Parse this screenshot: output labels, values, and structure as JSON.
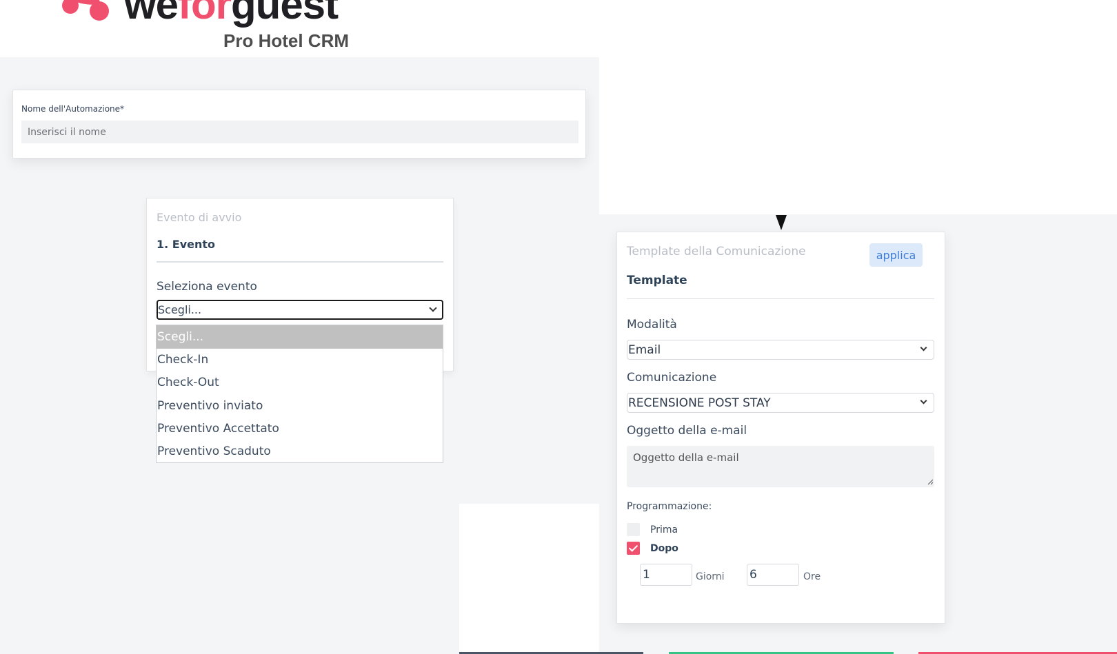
{
  "brand": {
    "wordmark_part1": "we",
    "wordmark_accent": "for",
    "wordmark_part2": "guest",
    "subtitle": "Pro Hotel CRM",
    "accent_color": "#f0506e"
  },
  "automation_name": {
    "label": "Nome dell'Automazione*",
    "placeholder": "Inserisci il nome",
    "value": ""
  },
  "event_card": {
    "kicker": "Evento di avvio",
    "heading": "1. Evento",
    "select_label": "Seleziona evento",
    "selected_value": "Scegli...",
    "options": [
      "Scegli...",
      "Check-In",
      "Check-Out",
      "Preventivo inviato",
      "Preventivo Accettato",
      "Preventivo Scaduto"
    ]
  },
  "template_card": {
    "kicker": "Template della Comunicazione",
    "apply_label": "applica",
    "heading": "Template",
    "mode_label": "Modalità",
    "mode_value": "Email",
    "communication_label": "Comunicazione",
    "communication_value": "RECENSIONE POST STAY",
    "subject_label": "Oggetto della e-mail",
    "subject_placeholder": "Oggetto della e-mail",
    "schedule_label": "Programmazione:",
    "before_label": "Prima",
    "before_checked": false,
    "after_label": "Dopo",
    "after_checked": true,
    "days_value": "1",
    "days_unit": "Giorni",
    "hours_value": "6",
    "hours_unit": "Ore"
  },
  "colors": {
    "strip_1": "#4a5566",
    "strip_2": "#35c486",
    "strip_3": "#f0506e"
  }
}
